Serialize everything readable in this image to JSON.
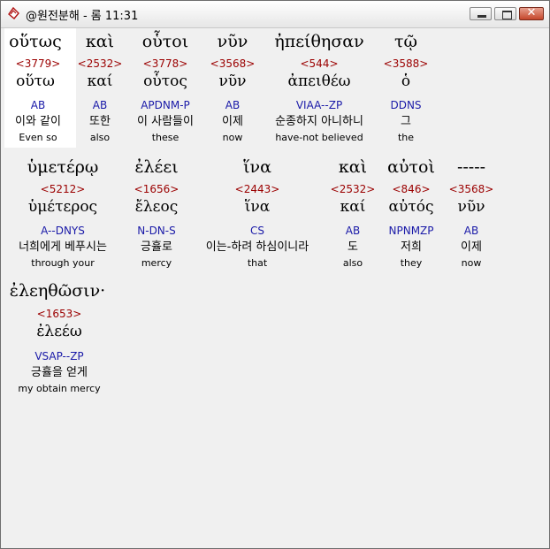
{
  "window": {
    "title": "@원전분해 - 롬 11:31",
    "app_icon": "bible-book-icon"
  },
  "rows": [
    [
      {
        "greek": "οὕτως",
        "strong": "<3779>",
        "lemma": "οὕτω",
        "parsing": "AB",
        "korean": "이와 같이",
        "english": "Even so"
      },
      {
        "greek": "καὶ",
        "strong": "<2532>",
        "lemma": "καί",
        "parsing": "AB",
        "korean": "또한",
        "english": "also"
      },
      {
        "greek": "οὗτοι",
        "strong": "<3778>",
        "lemma": "οὗτος",
        "parsing": "APDNM-P",
        "korean": "이 사람들이",
        "english": "these"
      },
      {
        "greek": "νῦν",
        "strong": "<3568>",
        "lemma": "νῦν",
        "parsing": "AB",
        "korean": "이제",
        "english": "now"
      },
      {
        "greek": "ἠπείθησαν",
        "strong": "<544>",
        "lemma": "ἀπειθέω",
        "parsing": "VIAA--ZP",
        "korean": "순종하지 아니하니",
        "english": "have-not believed"
      },
      {
        "greek": "τῷ",
        "strong": "<3588>",
        "lemma": "ὁ",
        "parsing": "DDNS",
        "korean": "그",
        "english": "the"
      }
    ],
    [
      {
        "greek": "ὑμετέρῳ",
        "strong": "<5212>",
        "lemma": "ὑμέτερος",
        "parsing": "A--DNYS",
        "korean": "너희에게 베푸시는",
        "english": "through your"
      },
      {
        "greek": "ἐλέει",
        "strong": "<1656>",
        "lemma": "ἔλεος",
        "parsing": "N-DN-S",
        "korean": "긍휼로",
        "english": "mercy"
      },
      {
        "greek": "ἵνα",
        "strong": "<2443>",
        "lemma": "ἵνα",
        "parsing": "CS",
        "korean": "이는-하려 하심이니라",
        "english": "that"
      },
      {
        "greek": "καὶ",
        "strong": "<2532>",
        "lemma": "καί",
        "parsing": "AB",
        "korean": "도",
        "english": "also"
      },
      {
        "greek": "αὐτοὶ",
        "strong": "<846>",
        "lemma": "αὐτός",
        "parsing": "NPNMZP",
        "korean": "저희",
        "english": "they"
      },
      {
        "greek": "-----",
        "strong": "<3568>",
        "lemma": "νῦν",
        "parsing": "AB",
        "korean": "이제",
        "english": "now"
      }
    ],
    [
      {
        "greek": "ἐλεηθῶσιν·",
        "strong": "<1653>",
        "lemma": "ἐλεέω",
        "parsing": "VSAP--ZP",
        "korean": "긍휼을 얻게",
        "english": "my obtain mercy"
      }
    ]
  ]
}
